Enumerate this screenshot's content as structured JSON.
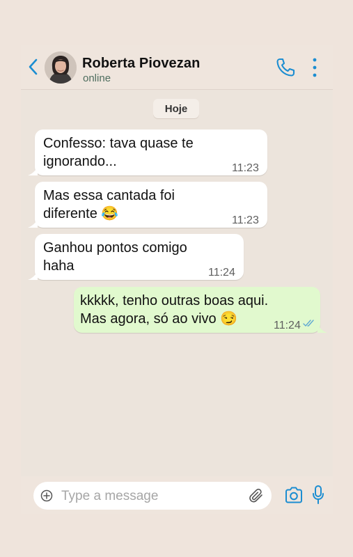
{
  "contact": {
    "name": "Roberta Piovezan",
    "status": "online"
  },
  "date_divider": "Hoje",
  "messages": [
    {
      "direction": "incoming",
      "lines": "Confesso: tava quase te\nignorando...",
      "time": "11:23"
    },
    {
      "direction": "incoming",
      "lines": "Mas essa cantada foi\ndiferente 😂",
      "time": "11:23"
    },
    {
      "direction": "incoming",
      "lines": "Ganhou pontos comigo\nhaha",
      "time": "11:24"
    },
    {
      "direction": "outgoing",
      "lines": "kkkkk, tenho outras boas aqui.\nMas agora, só ao vivo 😏",
      "time": "11:24",
      "read": true
    }
  ],
  "composer": {
    "placeholder": "Type a message"
  },
  "colors": {
    "accent": "#1b8dd1",
    "incoming_bubble": "#ffffff",
    "outgoing_bubble": "#e1f9ce",
    "read_ticks": "#5fa8d3",
    "background": "#ece4dc"
  },
  "icons": {
    "back": "chevron-left-icon",
    "call": "phone-icon",
    "menu": "more-vertical-icon",
    "attach": "paperclip-icon",
    "add": "plus-circle-icon",
    "camera": "camera-icon",
    "mic": "microphone-icon"
  }
}
